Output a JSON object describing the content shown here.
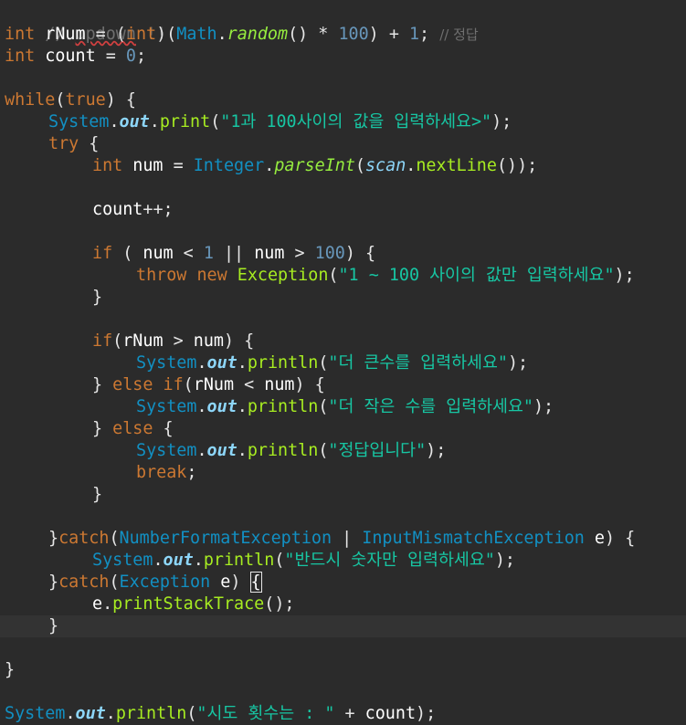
{
  "editor": {
    "lines": {
      "l1": {
        "a": "// ",
        "b": "updown",
        "c": " !!"
      },
      "l2": {
        "kw": "int",
        "v": " rNum",
        "op": " = (",
        "kw2": "int",
        "op2": ")(",
        "t": "Math",
        "dot": ".",
        "m": "random",
        "p": "() * ",
        "n": "100",
        "p2": ") + ",
        "n2": "1",
        "p3": "; ",
        "cm": "// 정답"
      },
      "l3": {
        "kw": "int",
        "v": " count",
        "op": " = ",
        "n": "0",
        "p": ";"
      },
      "l5": {
        "kw": "while",
        "p": "(",
        "kw2": "true",
        "p2": ") {"
      },
      "l6": {
        "t": "System",
        "dot": ".",
        "f": "out",
        "dot2": ".",
        "m": "print",
        "p": "(",
        "s": "\"1과 100사이의 값을 입력하세요>\"",
        "p2": ");"
      },
      "l7": {
        "kw": "try",
        "p": " {"
      },
      "l8": {
        "kw": "int",
        "v": " num",
        "op": " = ",
        "t": "Integer",
        "dot": ".",
        "m": "parseInt",
        "p": "(",
        "v2": "scan",
        "dot2": ".",
        "m2": "nextLine",
        "p2": "());"
      },
      "l10": {
        "v": "count",
        "p": "++;"
      },
      "l12": {
        "kw": "if",
        "p": " ( ",
        "v": "num",
        "op": " < ",
        "n": "1",
        "op2": " || ",
        "v2": "num",
        "op3": " > ",
        "n2": "100",
        "p2": ") {"
      },
      "l13": {
        "kw": "throw",
        "kw2": " new",
        "t": " Exception",
        "p": "(",
        "s": "\"1 ~ 100 사이의 값만 입력하세요\"",
        "p2": ");"
      },
      "l14": {
        "p": "}"
      },
      "l16": {
        "kw": "if",
        "p": "(",
        "v": "rNum",
        "op": " > ",
        "v2": "num",
        "p2": ") {"
      },
      "l17": {
        "t": "System",
        "dot": ".",
        "f": "out",
        "dot2": ".",
        "m": "println",
        "p": "(",
        "s": "\"더 큰수를 입력하세요\"",
        "p2": ");"
      },
      "l18": {
        "p": "} ",
        "kw": "else",
        "kw2": " if",
        "p2": "(",
        "v": "rNum",
        "op": " < ",
        "v2": "num",
        "p3": ") {"
      },
      "l19": {
        "t": "System",
        "dot": ".",
        "f": "out",
        "dot2": ".",
        "m": "println",
        "p": "(",
        "s": "\"더 작은 수를 입력하세요\"",
        "p2": ");"
      },
      "l20": {
        "p": "} ",
        "kw": "else",
        "p2": " {"
      },
      "l21": {
        "t": "System",
        "dot": ".",
        "f": "out",
        "dot2": ".",
        "m": "println",
        "p": "(",
        "s": "\"정답입니다\"",
        "p2": ");"
      },
      "l22": {
        "kw": "break",
        "p": ";"
      },
      "l23": {
        "p": "}"
      },
      "l25": {
        "p": "}",
        "kw": "catch",
        "p2": "(",
        "t": "NumberFormatException",
        "op": " | ",
        "t2": "InputMismatchException",
        "v": " e",
        "p3": ") {"
      },
      "l26": {
        "t": "System",
        "dot": ".",
        "f": "out",
        "dot2": ".",
        "m": "println",
        "p": "(",
        "s": "\"반드시 숫자만 입력하세요\"",
        "p2": ");"
      },
      "l27": {
        "p": "}",
        "kw": "catch",
        "p2": "(",
        "t": "Exception",
        "v": " e",
        "p3": ") ",
        "b": "{"
      },
      "l28": {
        "v": "e",
        "dot": ".",
        "m": "printStackTrace",
        "p": "();"
      },
      "l29": {
        "p": "}"
      },
      "l31": {
        "p": "}"
      },
      "l33": {
        "t": "System",
        "dot": ".",
        "f": "out",
        "dot2": ".",
        "m": "println",
        "p": "(",
        "s": "\"시도 횟수는 : \"",
        "op": " + ",
        "v": "count",
        "p2": ");"
      }
    }
  }
}
